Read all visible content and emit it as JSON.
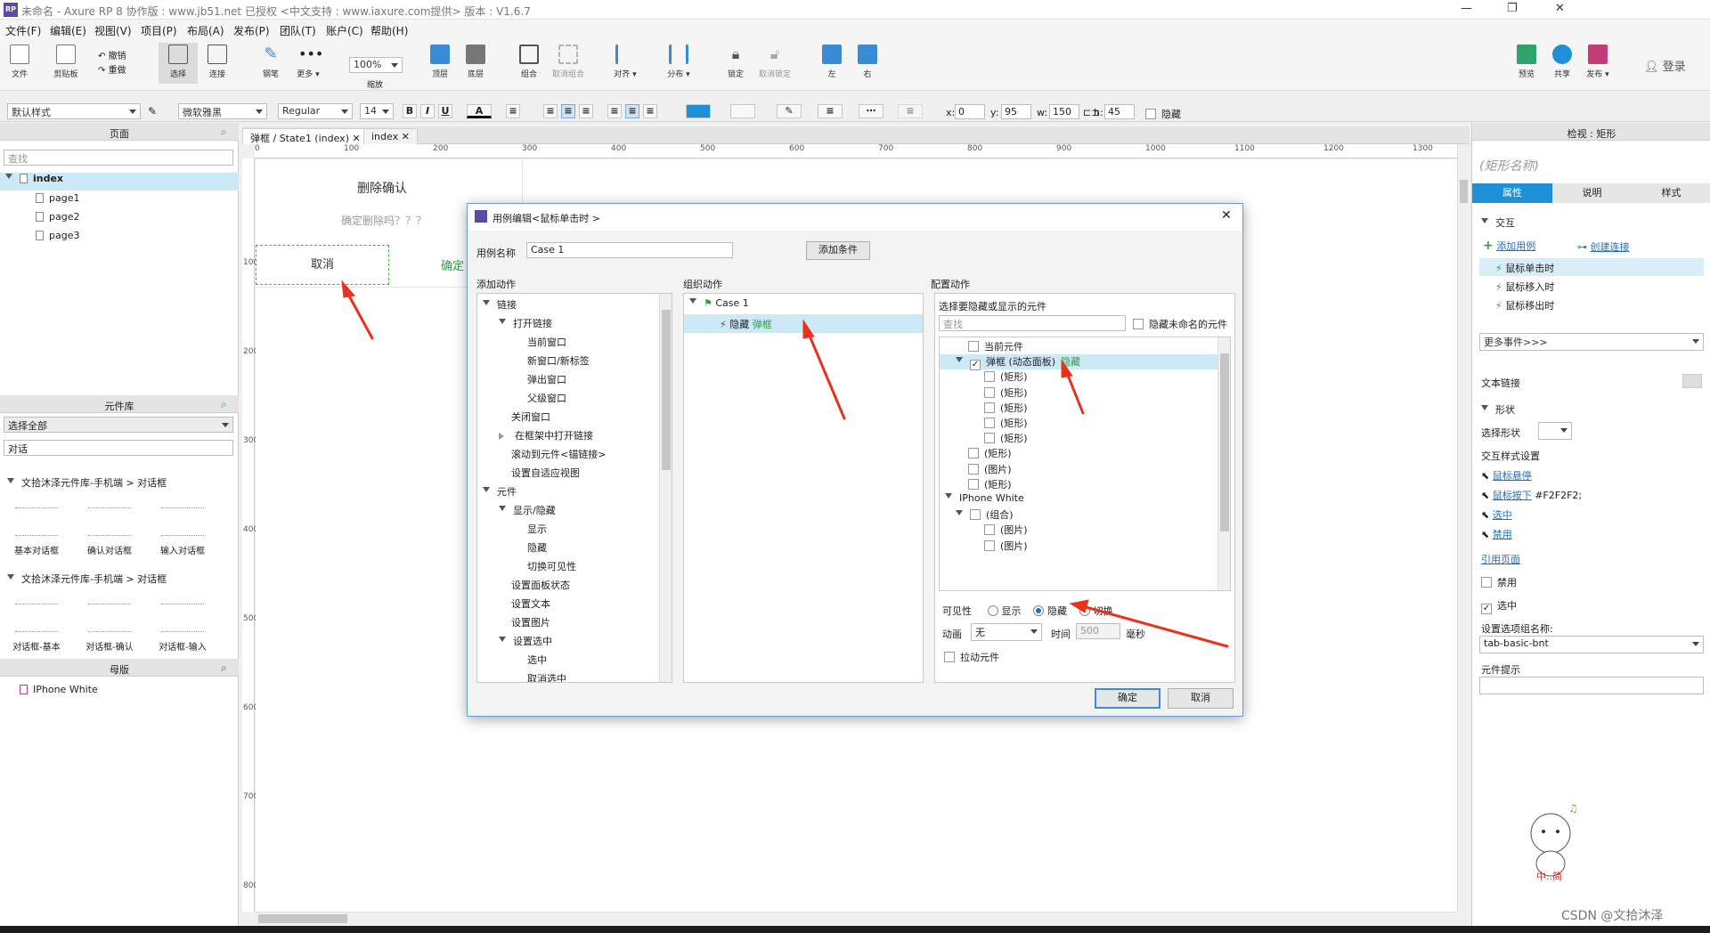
{
  "titlebar": {
    "title": "未命名 - Axure RP 8 协作版 : www.jb51.net  已授权      <中文支持 : www.iaxure.com提供> 版本 : V1.6.7"
  },
  "menu": [
    "文件(F)",
    "编辑(E)",
    "视图(V)",
    "项目(P)",
    "布局(A)",
    "发布(P)",
    "团队(T)",
    "账户(C)",
    "帮助(H)"
  ],
  "toolbar": {
    "file": "文件",
    "clipboard": "剪贴板",
    "undo": "撤销",
    "redo": "重做",
    "select": "选择",
    "connect": "连接",
    "pen": "钢笔",
    "more": "更多 ▾",
    "zoom_value": "100%",
    "zoom_label": "缩放",
    "top": "顶层",
    "bottom": "底层",
    "group": "组合",
    "ungroup": "取消组合",
    "align": "对齐 ▾",
    "distribute": "分布 ▾",
    "lock": "锁定",
    "unlock": "取消锁定",
    "left": "左",
    "right": "右",
    "preview": "预览",
    "share": "共享",
    "publish": "发布 ▾",
    "login": "登录"
  },
  "format": {
    "style": "默认样式",
    "font": "微软雅黑",
    "weight": "Regular",
    "size": "14",
    "x_label": "x:",
    "x": "0",
    "y_label": "y:",
    "y": "95",
    "w_label": "w:",
    "w": "150",
    "h_label": "h:",
    "h": "45",
    "hidden": "隐藏"
  },
  "pages_panel": {
    "title": "页面",
    "search_placeholder": "查找",
    "items": [
      {
        "label": "index"
      },
      {
        "label": "page1"
      },
      {
        "label": "page2"
      },
      {
        "label": "page3"
      }
    ]
  },
  "library_panel": {
    "title": "元件库",
    "select": "选择全部",
    "search": "对话",
    "group1": "文拾沐泽元件库-手机端 > 对话框",
    "group1_items": [
      "基本对话框",
      "确认对话框",
      "输入对话框"
    ],
    "group2": "文拾沐泽元件库-手机端 > 对话框",
    "group2_items": [
      "对话框-基本",
      "对话框-确认",
      "对话框-输入"
    ]
  },
  "masters_panel": {
    "title": "母版",
    "items": [
      "IPhone White"
    ]
  },
  "canvas": {
    "tabs": [
      "弹框 / State1 (index)",
      "index"
    ],
    "ruler_h": [
      "0",
      "100",
      "200",
      "300",
      "400",
      "500",
      "600",
      "700",
      "800",
      "900",
      "1000",
      "1100",
      "1200",
      "1300"
    ],
    "ruler_v": [
      "100",
      "200",
      "300",
      "400",
      "500",
      "600",
      "700",
      "800"
    ],
    "title_text": "删除确认",
    "sub_text": "确定删除吗？？？",
    "cancel": "取消",
    "ok": "确定"
  },
  "dialog": {
    "title": "用例编辑<鼠标单击时 >",
    "case_label": "用例名称",
    "case_value": "Case 1",
    "add_condition": "添加条件",
    "col1": "添加动作",
    "col2": "组织动作",
    "col3": "配置动作",
    "actions": [
      {
        "label": "链接",
        "level": 0,
        "exp": "down"
      },
      {
        "label": "打开链接",
        "level": 1,
        "exp": "down"
      },
      {
        "label": "当前窗口",
        "level": 2
      },
      {
        "label": "新窗口/新标签",
        "level": 2
      },
      {
        "label": "弹出窗口",
        "level": 2
      },
      {
        "label": "父级窗口",
        "level": 2
      },
      {
        "label": "关闭窗口",
        "level": 1
      },
      {
        "label": "在框架中打开链接",
        "level": 1,
        "exp": "right"
      },
      {
        "label": "滚动到元件<锚链接>",
        "level": 1
      },
      {
        "label": "设置自适应视图",
        "level": 1
      },
      {
        "label": "元件",
        "level": 0,
        "exp": "down"
      },
      {
        "label": "显示/隐藏",
        "level": 1,
        "exp": "down"
      },
      {
        "label": "显示",
        "level": 2
      },
      {
        "label": "隐藏",
        "level": 2
      },
      {
        "label": "切换可见性",
        "level": 2
      },
      {
        "label": "设置面板状态",
        "level": 1
      },
      {
        "label": "设置文本",
        "level": 1
      },
      {
        "label": "设置图片",
        "level": 1
      },
      {
        "label": "设置选中",
        "level": 1,
        "exp": "down"
      },
      {
        "label": "选中",
        "level": 2
      },
      {
        "label": "取消选中",
        "level": 2
      }
    ],
    "organize": {
      "case": "Case 1",
      "action_verb": "隐藏",
      "action_target": "弹框"
    },
    "config": {
      "select_title": "选择要隐藏或显示的元件",
      "search_placeholder": "查找",
      "hide_unnamed": "隐藏未命名的元件",
      "rows": [
        {
          "label": "当前元件",
          "level": 0,
          "checked": false
        },
        {
          "label": "弹框 (动态面板)",
          "level": 0,
          "checked": true,
          "exp": "down",
          "tag": "隐藏"
        },
        {
          "label": "(矩形)",
          "level": 1,
          "checked": false
        },
        {
          "label": "(矩形)",
          "level": 1,
          "checked": false
        },
        {
          "label": "(矩形)",
          "level": 1,
          "checked": false
        },
        {
          "label": "(矩形)",
          "level": 1,
          "checked": false
        },
        {
          "label": "(矩形)",
          "level": 1,
          "checked": false
        },
        {
          "label": "(矩形)",
          "level": 0,
          "checked": false
        },
        {
          "label": "(图片)",
          "level": 0,
          "checked": false
        },
        {
          "label": "(矩形)",
          "level": 0,
          "checked": false
        },
        {
          "label": "IPhone White",
          "level": -1,
          "exp": "down"
        },
        {
          "label": "(组合)",
          "level": 0,
          "checked": false,
          "exp": "down"
        },
        {
          "label": "(图片)",
          "level": 1,
          "checked": false
        },
        {
          "label": "(图片)",
          "level": 1,
          "checked": false
        }
      ],
      "visibility_label": "可见性",
      "opt_show": "显示",
      "opt_hide": "隐藏",
      "opt_toggle": "切换",
      "selected_option": "隐藏",
      "anim_label": "动画",
      "anim_value": "无",
      "time_label": "时间",
      "time_value": "500",
      "ms": "毫秒",
      "pull": "拉动元件"
    },
    "ok": "确定",
    "cancel": "取消"
  },
  "inspector": {
    "title": "检视 : 矩形",
    "name_placeholder": "(矩形名称)",
    "tabs": [
      "属性",
      "说明",
      "样式"
    ],
    "interaction": "交互",
    "add_case": "添加用例",
    "create_link": "创建连接",
    "events": [
      "鼠标单击时",
      "鼠标移入时",
      "鼠标移出时"
    ],
    "more_events": "更多事件>>>",
    "text_link": "文本链接",
    "shape": "形状",
    "select_shape": "选择形状",
    "interaction_style": "交互样式设置",
    "hover": "鼠标悬停",
    "mousedown": "鼠标按下",
    "mousedown_value": "#F2F2F2;",
    "selected": "选中",
    "disabled": "禁用",
    "ref_page": "引用页面",
    "cb_disabled": "禁用",
    "cb_selected": "选中",
    "group_name_label": "设置选项组名称:",
    "group_name_value": "tab-basic-bnt",
    "tooltip_label": "元件提示"
  },
  "watermark": "CSDN @文拾沐泽",
  "colors": {
    "accent": "#1e90d8",
    "link": "#1f6fc0",
    "green": "#2e9e44",
    "arrow": "#e8321e"
  }
}
